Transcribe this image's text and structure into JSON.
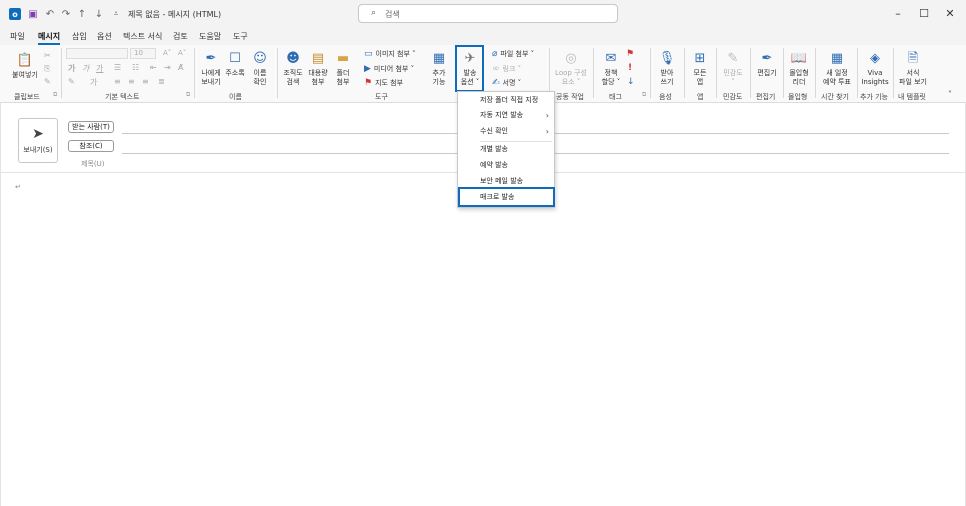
{
  "window": {
    "title": "제목 없음 - 메시지 (HTML)",
    "search_placeholder": "검색"
  },
  "menu": [
    "파일",
    "메시지",
    "삽입",
    "옵션",
    "텍스트 서식",
    "검토",
    "도움말",
    "도구"
  ],
  "ribbon": {
    "paste": "붙여넣기",
    "font_size": "10",
    "send_to_me_1": "나에게",
    "send_to_me_2": "보내기",
    "address_book": "주소록",
    "check_names_1": "이름",
    "check_names_2": "확인",
    "org_search_1": "조직도",
    "org_search_2": "검색",
    "large_attach_1": "대용량",
    "large_attach_2": "첨부",
    "folder_attach_1": "폴더",
    "folder_attach_2": "첨부",
    "image_attach": "이미지 첨부 ˅",
    "media_attach": "미디어 첨부 ˅",
    "map_attach": "지도 첨부",
    "addins_1": "추가",
    "addins_2": "기능",
    "send_options_1": "발송",
    "send_options_2": "옵션 ˅",
    "file_attach": "파일 첨부 ˅",
    "link": "링크 ˅",
    "signature": "서명 ˅",
    "loop_1": "Loop 구성",
    "loop_2": "요소 ˅",
    "policy_1": "정책",
    "policy_2": "할당 ˅",
    "dictate_1": "받아",
    "dictate_2": "쓰기",
    "all_apps_1": "모든",
    "all_apps_2": "앱",
    "sensitivity_1": "민감도",
    "sensitivity_2": "˅",
    "editor": "편집기",
    "reader_1": "몰입형",
    "reader_2": "리더",
    "new_poll_1": "새 일정",
    "new_poll_2": "예약 투표",
    "viva_1": "Viva",
    "viva_2": "Insights",
    "template_1": "서식",
    "template_2": "파일 보기"
  },
  "groups": {
    "clipboard": "클립보드",
    "basic_text": "기본 텍스트",
    "names": "이름",
    "tools": "도구",
    "collab": "공동 작업",
    "tags": "태그",
    "voice": "음성",
    "apps": "앱",
    "sensitivity": "민감도",
    "editor": "편집기",
    "immersive": "몰입형",
    "find_time": "시간 찾기",
    "addins": "추가 기능",
    "my_templates": "내 템플릿"
  },
  "compose": {
    "send": "보내기(S)",
    "to": "받는 사람(T)",
    "cc": "참조(C)",
    "subject": "제목(U)"
  },
  "dropdown": {
    "items": [
      "저장 폴더 직접 지정",
      "자동 지연 발송",
      "수신 확인",
      "개별 발송",
      "예약 발송",
      "보안 메일 발송",
      "매크로 발송"
    ]
  },
  "colors": {
    "accent": "#0f6cbd",
    "flag": "#d13438"
  }
}
